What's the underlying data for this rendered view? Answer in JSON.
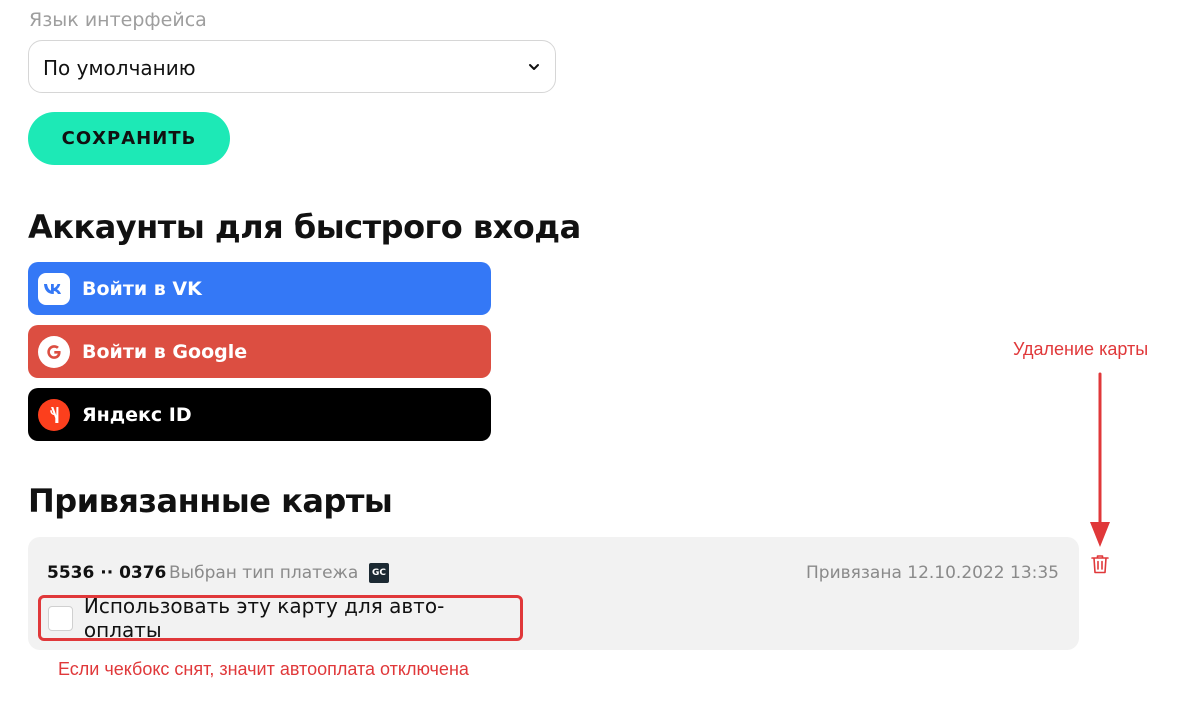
{
  "language": {
    "label": "Язык интерфейса",
    "selected": "По умолчанию"
  },
  "save_button": "СОХРАНИТЬ",
  "accounts": {
    "title": "Аккаунты для быстрого входа",
    "vk": "Войти в VK",
    "google": "Войти в Google",
    "yandex": "Яндекс ID"
  },
  "cards": {
    "title": "Привязанные карты",
    "items": [
      {
        "number": "5536 ·· 0376",
        "payment_type": "Выбран тип платежа",
        "payment_logo": "GC",
        "linked": "Привязана 12.10.2022 13:35",
        "auto_pay_label": "Использовать эту карту для авто-оплаты",
        "auto_pay_checked": false
      }
    ]
  },
  "annotations": {
    "delete_card": "Удаление карты",
    "auto_pay_note": "Если чекбокс снят, значит автооплата отключена"
  },
  "colors": {
    "accent": "#1de9b6",
    "vk": "#3478f6",
    "google": "#dc4e41",
    "yandex": "#000000",
    "annotation": "#e0383a",
    "trash": "#e0383a"
  },
  "icons": [
    "chevron-down-icon",
    "vk-icon",
    "google-icon",
    "yandex-icon",
    "gc-logo-icon",
    "trash-icon",
    "arrow-down-icon"
  ]
}
